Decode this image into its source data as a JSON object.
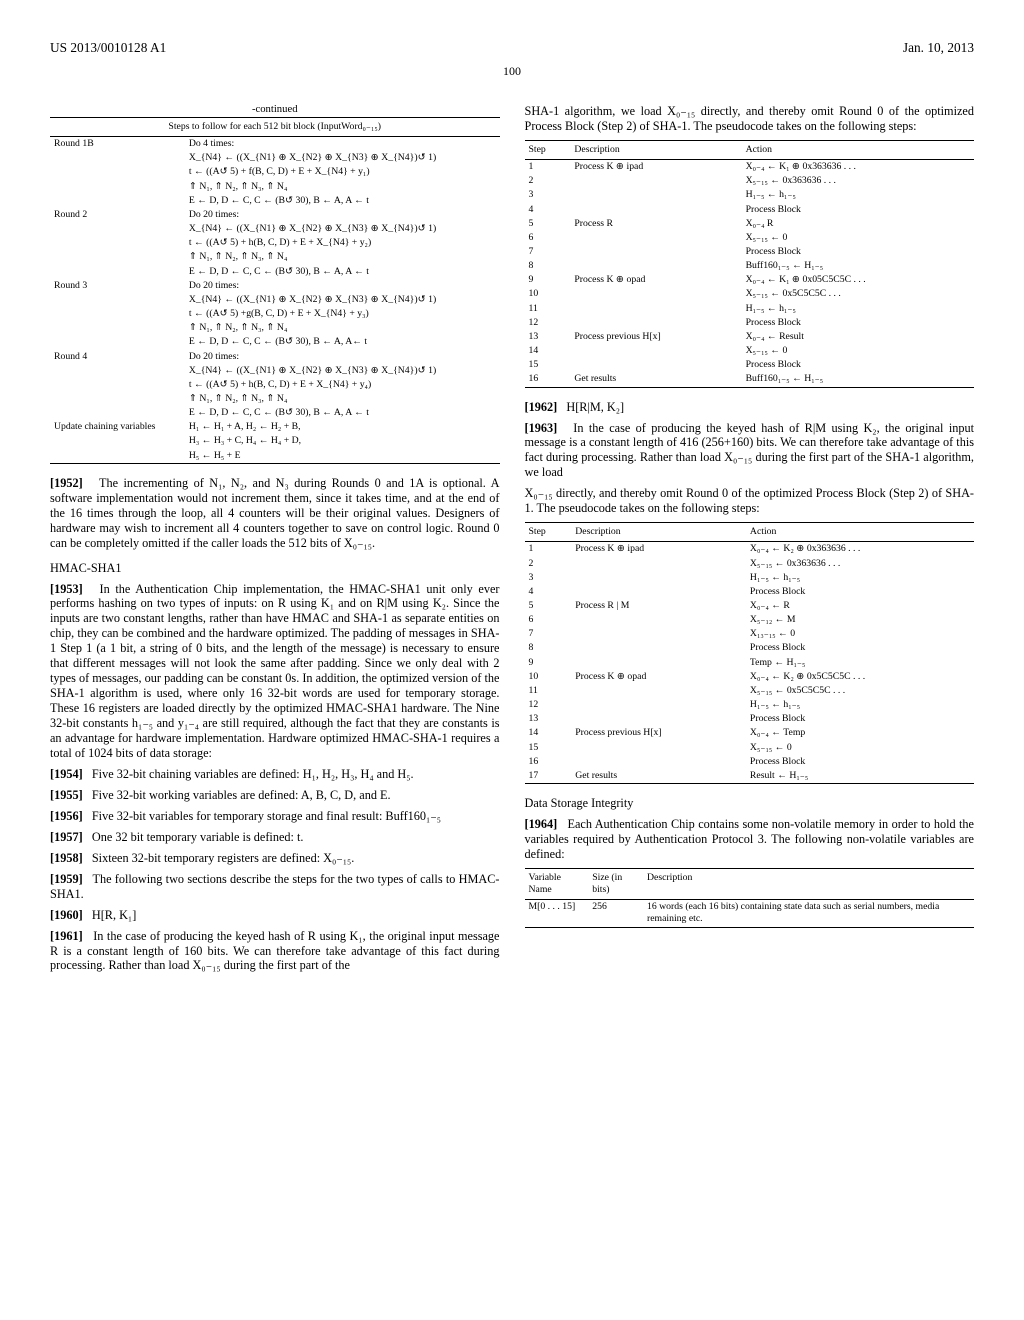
{
  "header": {
    "left": "US 2013/0010128 A1",
    "right": "Jan. 10, 2013"
  },
  "pagenum": "100",
  "left": {
    "continued": "-continued",
    "table1_title": "Steps to follow for each 512 bit block (InputWord₀₋₁₅)",
    "table1": [
      [
        "Round 1B",
        "Do 4 times:"
      ],
      [
        "",
        "X_{N4} ← ((X_{N1} ⊕ X_{N2} ⊕ X_{N3} ⊕ X_{N4})↺ 1)"
      ],
      [
        "",
        "t ← ((A↺ 5) + f(B, C, D) + E + X_{N4} + y₁)"
      ],
      [
        "",
        "⇑ N₁, ⇑ N₂, ⇑ N₃, ⇑ N₄"
      ],
      [
        "",
        "E ← D, D ← C, C ← (B↺ 30), B ← A, A ← t"
      ],
      [
        "Round 2",
        "Do 20 times:"
      ],
      [
        "",
        "X_{N4} ← ((X_{N1} ⊕ X_{N2} ⊕ X_{N3} ⊕ X_{N4})↺ 1)"
      ],
      [
        "",
        "t ← ((A↺ 5) + h(B, C, D) + E + X_{N4} + y₂)"
      ],
      [
        "",
        "⇑ N₁, ⇑ N₂, ⇑ N₃, ⇑ N₄"
      ],
      [
        "",
        "E ← D, D ← C, C ← (B↺ 30), B ← A, A ← t"
      ],
      [
        "Round 3",
        "Do 20 times:"
      ],
      [
        "",
        "X_{N4} ← ((X_{N1} ⊕ X_{N2} ⊕ X_{N3} ⊕ X_{N4})↺ 1)"
      ],
      [
        "",
        "t ← ((A↺ 5) +g(B, C, D) + E + X_{N4} + y₃)"
      ],
      [
        "",
        "⇑ N₁, ⇑ N₂, ⇑ N₃, ⇑ N₄"
      ],
      [
        "",
        "E ← D, D ← C, C ← (B↺ 30), B ← A, A← t"
      ],
      [
        "Round 4",
        "Do 20 times:"
      ],
      [
        "",
        "X_{N4} ← ((X_{N1} ⊕ X_{N2} ⊕ X_{N3} ⊕ X_{N4})↺ 1)"
      ],
      [
        "",
        "t ← ((A↺ 5) + h(B, C, D) + E + X_{N4} + y₄)"
      ],
      [
        "",
        "⇑ N₁, ⇑ N₂, ⇑ N₃, ⇑ N₄"
      ],
      [
        "",
        "E ← D, D ← C, C ← (B↺ 30), B ← A, A ← t"
      ],
      [
        "Update chaining variables",
        "H₁ ← H₁ + A, H₂ ← H₂ + B,"
      ],
      [
        "",
        "H₃ ← H₃ + C, H₄ ← H₄ + D,"
      ],
      [
        "",
        "H₅ ← H₅ + E"
      ]
    ],
    "p1952": "The incrementing of N₁, N₂, and N₃ during Rounds 0 and 1A is optional. A software implementation would not increment them, since it takes time, and at the end of the 16 times through the loop, all 4 counters will be their original values. Designers of hardware may wish to increment all 4 counters together to save on control logic. Round 0 can be completely omitted if the caller loads the 512 bits of X₀₋₁₅.",
    "sec1": "HMAC-SHA1",
    "p1953": "In the Authentication Chip implementation, the HMAC-SHA1 unit only ever performs hashing on two types of inputs: on R using K₁ and on R|M using K₂. Since the inputs are two constant lengths, rather than have HMAC and SHA-1 as separate entities on chip, they can be combined and the hardware optimized. The padding of messages in SHA-1 Step 1 (a 1 bit, a string of 0 bits, and the length of the message) is necessary to ensure that different messages will not look the same after padding. Since we only deal with 2 types of messages, our padding can be constant 0s. In addition, the optimized version of the SHA-1 algorithm is used, where only 16 32-bit words are used for temporary storage. These 16 registers are loaded directly by the optimized HMAC-SHA1 hardware. The Nine 32-bit constants h₁₋₅ and y₁₋₄ are still required, although the fact that they are constants is an advantage for hardware implementation. Hardware optimized HMAC-SHA-1 requires a total of 1024 bits of data storage:",
    "p1954": "Five 32-bit chaining variables are defined: H₁, H₂, H₃, H₄ and H₅.",
    "p1955": "Five 32-bit working variables are defined: A, B, C, D, and E.",
    "p1956": "Five 32-bit variables for temporary storage and final result: Buff160₁₋₅",
    "p1957": "One 32 bit temporary variable is defined: t.",
    "p1958": "Sixteen 32-bit temporary registers are defined: X₀₋₁₅.",
    "p1959": "The following two sections describe the steps for the two types of calls to HMAC-SHA1.",
    "p1960": "H[R, K₁]",
    "p1961": "In the case of producing the keyed hash of R using K₁, the original input message R is a constant length of 160 bits. We can therefore take advantage of this fact during processing. Rather than load X₀₋₁₅ during the first part of the"
  },
  "right": {
    "intro": "SHA-1 algorithm, we load X₀₋₁₅ directly, and thereby omit Round 0 of the optimized Process Block (Step 2) of SHA-1. The pseudocode takes on the following steps:",
    "t2_h1": "Step",
    "t2_h2": "Description",
    "t2_h3": "Action",
    "t2": [
      [
        "1",
        "Process K ⊕ ipad",
        "X₀₋₄ ← K₁ ⊕ 0x363636 . . ."
      ],
      [
        "2",
        "",
        "X₅₋₁₅ ← 0x363636 . . ."
      ],
      [
        "3",
        "",
        "H₁₋₅ ← h₁₋₅"
      ],
      [
        "4",
        "",
        "Process Block"
      ],
      [
        "5",
        "Process R",
        "X₀₋₄ R"
      ],
      [
        "6",
        "",
        "X₅₋₁₅ ← 0"
      ],
      [
        "7",
        "",
        "Process Block"
      ],
      [
        "8",
        "",
        "Buff160₁₋₅ ← H₁₋₅"
      ],
      [
        "9",
        "Process K ⊕ opad",
        "X₀₋₄ ← K₁ ⊕ 0x05C5C5C . . ."
      ],
      [
        "10",
        "",
        "X₅₋₁₅ ← 0x5C5C5C . . ."
      ],
      [
        "11",
        "",
        "H₁₋₅ ← h₁₋₅"
      ],
      [
        "12",
        "",
        "Process Block"
      ],
      [
        "13",
        "Process previous H[x]",
        "X₀₋₄ ← Result"
      ],
      [
        "14",
        "",
        "X₅₋₁₅ ← 0"
      ],
      [
        "15",
        "",
        "Process Block"
      ],
      [
        "16",
        "Get results",
        "Buff160₁₋₅ ← H₁₋₅"
      ]
    ],
    "p1962": "H[R|M, K₂]",
    "p1963": "In the case of producing the keyed hash of R|M using K₂, the original input message is a constant length of 416 (256+160) bits. We can therefore take advantage of this fact during processing. Rather than load X₀₋₁₅ during the first part of the SHA-1 algorithm, we load",
    "mid": "X₀₋₁₅ directly, and thereby omit Round 0 of the optimized Process Block (Step 2) of SHA-1. The pseudocode takes on the following steps:",
    "t3": [
      [
        "1",
        "Process K ⊕ ipad",
        "X₀₋₄ ← K₂ ⊕ 0x363636 . . ."
      ],
      [
        "2",
        "",
        "X₅₋₁₅ ← 0x363636 . . ."
      ],
      [
        "3",
        "",
        "H₁₋₅ ← h₁₋₅"
      ],
      [
        "4",
        "",
        "Process Block"
      ],
      [
        "5",
        "Process R | M",
        "X₀₋₄ ← R"
      ],
      [
        "6",
        "",
        "X₅₋₁₂ ← M"
      ],
      [
        "7",
        "",
        "X₁₃₋₁₅ ← 0"
      ],
      [
        "8",
        "",
        "Process Block"
      ],
      [
        "9",
        "",
        "Temp ← H₁₋₅"
      ],
      [
        "10",
        "Process K ⊕ opad",
        "X₀₋₄ ← K₂ ⊕ 0x5C5C5C . . ."
      ],
      [
        "11",
        "",
        "X₅₋₁₅ ← 0x5C5C5C . . ."
      ],
      [
        "12",
        "",
        "H₁₋₅ ← h₁₋₅"
      ],
      [
        "13",
        "",
        "Process Block"
      ],
      [
        "14",
        "Process previous H[x]",
        "X₀₋₄ ← Temp"
      ],
      [
        "15",
        "",
        "X₅₋₁₅ ← 0"
      ],
      [
        "16",
        "",
        "Process Block"
      ],
      [
        "17",
        "Get results",
        "Result ← H₁₋₅"
      ]
    ],
    "sec2": "Data Storage Integrity",
    "p1964": "Each Authentication Chip contains some non-volatile memory in order to hold the variables required by Authentication Protocol 3. The following non-volatile variables are defined:",
    "t4_h1": "Variable Name",
    "t4_h2": "Size (in bits)",
    "t4_h3": "Description",
    "t4": [
      [
        "M[0 . . . 15]",
        "256",
        "16 words (each 16 bits) containing state data such as serial numbers, media remaining etc."
      ]
    ]
  }
}
